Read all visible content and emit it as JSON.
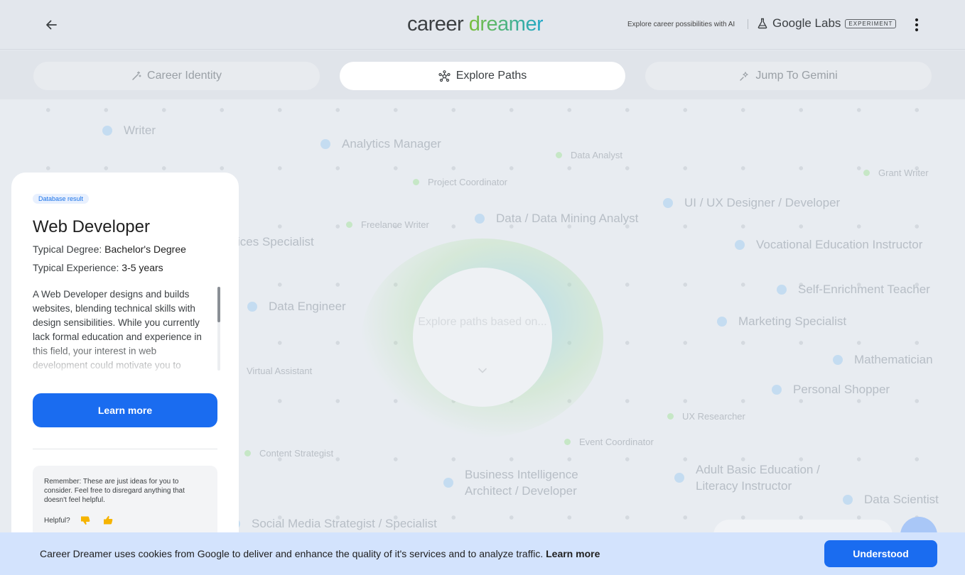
{
  "header": {
    "logo_word1": "career",
    "logo_word2": "dreamer",
    "tagline": "Explore career possibilities with AI",
    "labs_name": "Google Labs",
    "experiment_badge": "EXPERIMENT"
  },
  "tabs": [
    {
      "label": "Career Identity",
      "icon": "wand-icon",
      "active": false
    },
    {
      "label": "Explore Paths",
      "icon": "network-icon",
      "active": true
    },
    {
      "label": "Jump To Gemini",
      "icon": "sparkle-icon",
      "active": false
    }
  ],
  "canvas": {
    "center_text": "Explore paths based on...",
    "nodes": {
      "writer": "Writer",
      "analytics_manager": "Analytics Manager",
      "data_analyst": "Data Analyst",
      "grant_writer": "Grant Writer",
      "project_coordinator": "Project Coordinator",
      "ui_ux_designer": "UI / UX Designer / Developer",
      "freelance_writer": "Freelance Writer",
      "data_mining_analyst": "Data / Data Mining Analyst",
      "services_specialist": "ices Specialist",
      "vocational_instructor": "Vocational Education Instructor",
      "self_enrichment_teacher": "Self-Enrichment Teacher",
      "data_engineer": "Data Engineer",
      "marketing_specialist": "Marketing Specialist",
      "mathematician": "Mathematician",
      "virtual_assistant": "Virtual Assistant",
      "personal_shopper": "Personal Shopper",
      "ux_researcher": "UX Researcher",
      "event_coordinator": "Event Coordinator",
      "content_strategist": "Content Strategist",
      "bi_architect": "Business Intelligence Architect / Developer",
      "adult_education_instructor": "Adult Basic Education / Literacy Instructor",
      "data_scientist": "Data Scientist",
      "social_media_strategist": "Social Media Strategist / Specialist"
    }
  },
  "card": {
    "badge": "Database result",
    "title": "Web Developer",
    "degree_label": "Typical Degree: ",
    "degree_value": "Bachelor's Degree",
    "experience_label": "Typical Experience: ",
    "experience_value": "3-5 years",
    "description": "A Web Developer designs and builds websites, blending technical skills with design sensibilities. While you currently lack formal education and experience in this field, your interest in web development could motivate you to",
    "learn_more": "Learn more",
    "remember": "Remember: These are just ideas for you to consider. Feel free to disregard anything that doesn't feel helpful.",
    "helpful_label": "Helpful?"
  },
  "cookie": {
    "text": "Career Dreamer uses cookies from Google to deliver and enhance the quality of it's services and to analyze traffic.",
    "link": "Learn more",
    "button": "Understood"
  },
  "colors": {
    "primary_button": "#1a6cf0",
    "cookie_bar": "#d3e3fd",
    "node_dot_blue": "#c4dcf1",
    "node_dot_green": "#c6e7c6"
  }
}
